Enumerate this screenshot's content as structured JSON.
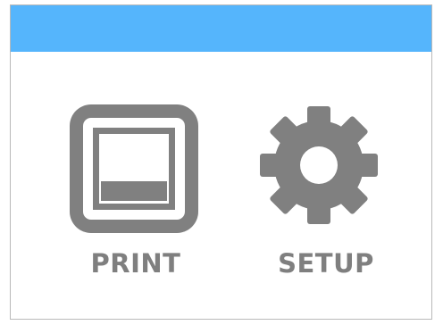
{
  "colors": {
    "header": "#55b5fc",
    "icon": "#808080",
    "label": "#7f7f7f"
  },
  "menu": {
    "print": {
      "label": "PRINT",
      "icon": "print-icon"
    },
    "setup": {
      "label": "SETUP",
      "icon": "gear-icon"
    }
  }
}
